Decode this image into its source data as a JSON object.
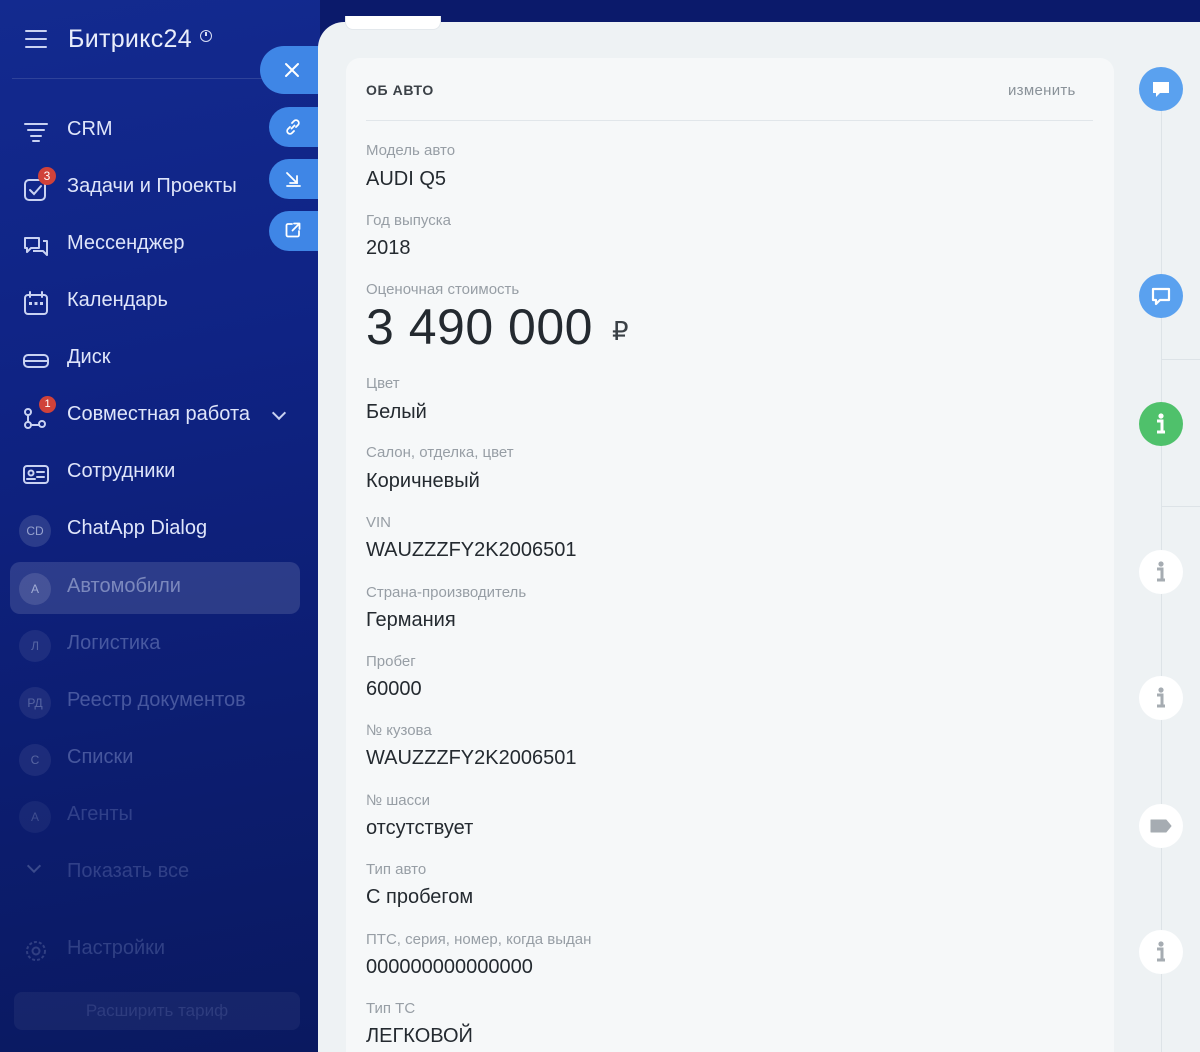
{
  "sidebar": {
    "brand": "Битрикс24",
    "items": [
      {
        "label": "CRM",
        "icon": "crm-funnel-icon"
      },
      {
        "label": "Задачи и Проекты",
        "icon": "tasks-check-icon",
        "badge": "3"
      },
      {
        "label": "Мессенджер",
        "icon": "messenger-chat-icon"
      },
      {
        "label": "Календарь",
        "icon": "calendar-icon"
      },
      {
        "label": "Диск",
        "icon": "disk-icon"
      },
      {
        "label": "Совместная работа",
        "icon": "collaboration-icon",
        "badge": "1"
      },
      {
        "label": "Сотрудники",
        "icon": "employees-card-icon"
      },
      {
        "label": "ChatApp Dialog",
        "initials": "CD"
      },
      {
        "label": "Автомобили",
        "initials": "А"
      },
      {
        "label": "Логистика",
        "initials": "Л"
      },
      {
        "label": "Реестр документов",
        "initials": "РД"
      },
      {
        "label": "Списки",
        "initials": "С"
      },
      {
        "label": "Агенты",
        "initials": "А"
      },
      {
        "label": "Показать все",
        "icon": "chevron-down-icon"
      },
      {
        "label": "Настройки",
        "icon": "gear-icon"
      }
    ],
    "upgrade_label": "Расширить тариф"
  },
  "card": {
    "title": "ОБ АВТО",
    "edit_label": "изменить",
    "model": {
      "label": "Модель авто",
      "value": "AUDI Q5"
    },
    "year": {
      "label": "Год выпуска",
      "value": "2018"
    },
    "price": {
      "label": "Оценочная стоимость",
      "value": "3 490 000",
      "currency": "₽"
    },
    "color": {
      "label": "Цвет",
      "value": "Белый"
    },
    "interior": {
      "label": "Салон, отделка, цвет",
      "value": "Коричневый"
    },
    "vin": {
      "label": "VIN",
      "value": "WAUZZZFY2K2006501"
    },
    "country": {
      "label": "Страна-производитель",
      "value": "Германия"
    },
    "mileage": {
      "label": "Пробег",
      "value": "60000"
    },
    "body_no": {
      "label": "№ кузова",
      "value": "WAUZZZFY2K2006501"
    },
    "chassis_no": {
      "label": "№ шасси",
      "value": "отсутствует"
    },
    "car_type": {
      "label": "Тип авто",
      "value": "С пробегом"
    },
    "pts": {
      "label": "ПТС, серия, номер, когда выдан",
      "value": "000000000000000"
    },
    "vehicle_type": {
      "label": "Тип ТС",
      "value": "ЛЕГКОВОЙ"
    }
  },
  "colors": {
    "accent_blue": "#3f86e6",
    "timeline_blue": "#5aa1ef",
    "timeline_green": "#4fc16b",
    "badge_red": "#d0423a"
  }
}
